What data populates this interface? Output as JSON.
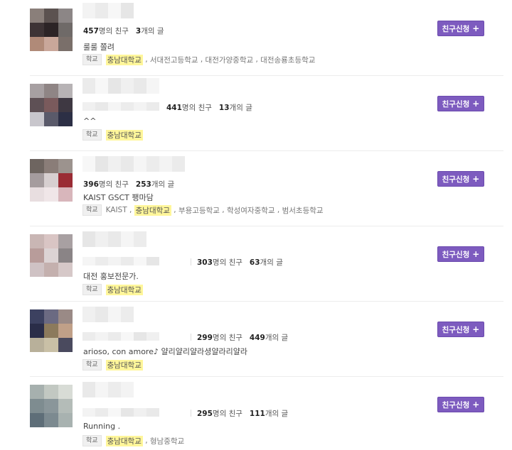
{
  "school_tag": "학교",
  "add_friend_label": "친구신청",
  "plus_glyph": "+",
  "friend_suffix": "명의 친구",
  "post_suffix": "개의 글",
  "users": [
    {
      "friends": "457",
      "posts": "3",
      "bio": "룰룰 쫄려",
      "schools": [
        "충남대학교",
        "서대전고등학교",
        "대전가양중학교",
        "대전송룡초등학교"
      ],
      "highlight": 0,
      "avatar": [
        "#8a7f7a",
        "#5c5250",
        "#8c8686",
        "#3d3335",
        "#2c2426",
        "#6f6a68",
        "#b08a78",
        "#c9a79a",
        "#7a6f6a"
      ]
    },
    {
      "friends": "441",
      "posts": "13",
      "bio": "^^",
      "schools": [
        "충남대학교"
      ],
      "highlight": 0,
      "avatar": [
        "#a7a0a2",
        "#8f8585",
        "#b7b3b5",
        "#5e5055",
        "#7a5a5c",
        "#3e3842",
        "#c8c6cc",
        "#5a5a6a",
        "#2c2f45"
      ]
    },
    {
      "friends": "396",
      "posts": "253",
      "bio": "KAIST GSCT 팽마담",
      "schools": [
        "KAIST",
        "충남대학교",
        "부용고등학교",
        "학성여자중학교",
        "범서초등학교"
      ],
      "highlight": 1,
      "avatar": [
        "#6e6560",
        "#8a7d78",
        "#9c938e",
        "#a59c9e",
        "#d7cfd0",
        "#9a2c34",
        "#e8dee0",
        "#f0e6e8",
        "#d8b6bb"
      ]
    },
    {
      "friends": "303",
      "posts": "63",
      "bio": "대전 홍보전문가.",
      "schools": [
        "충남대학교"
      ],
      "highlight": 0,
      "avatar": [
        "#c9b6b4",
        "#d9c5c4",
        "#a8a0a2",
        "#b89c9a",
        "#dcd3d4",
        "#8a8486",
        "#cfc2c4",
        "#c4b0ae",
        "#d6c8c8"
      ]
    },
    {
      "friends": "299",
      "posts": "449",
      "bio": "arioso, con amore♪ 얄리얄리얄라셩얄라리얄라",
      "schools": [
        "충남대학교"
      ],
      "highlight": 0,
      "avatar": [
        "#3c4160",
        "#6b6a82",
        "#9a8a86",
        "#2a2d48",
        "#8c7a5c",
        "#c0a088",
        "#b8b09a",
        "#c9c0a6",
        "#4a4a5e"
      ]
    },
    {
      "friends": "295",
      "posts": "111",
      "bio": "Running .",
      "schools": [
        "충남대학교",
        "형남중학교"
      ],
      "highlight": 0,
      "avatar": [
        "#a6b0ae",
        "#c2c8c2",
        "#d8dcd6",
        "#7e8c90",
        "#8a969a",
        "#b4bcb8",
        "#5e6e78",
        "#7c8a90",
        "#a8b2b0"
      ]
    }
  ]
}
